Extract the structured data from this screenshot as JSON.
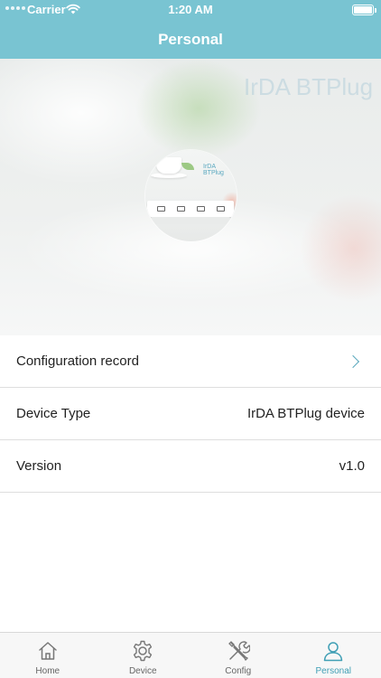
{
  "status_bar": {
    "carrier": "Carrier",
    "time": "1:20 AM"
  },
  "nav": {
    "title": "Personal"
  },
  "hero": {
    "watermark": "IrDA BTPlug",
    "logo_label": "IrDA BTPlug"
  },
  "list": {
    "rows": [
      {
        "label": "Configuration record",
        "value": ""
      },
      {
        "label": "Device Type",
        "value": "IrDA BTPlug device"
      },
      {
        "label": "Version",
        "value": "v1.0"
      }
    ]
  },
  "tabbar": {
    "tabs": [
      {
        "label": "Home",
        "icon": "home-icon"
      },
      {
        "label": "Device",
        "icon": "gear-icon"
      },
      {
        "label": "Config",
        "icon": "tools-icon"
      },
      {
        "label": "Personal",
        "icon": "person-icon"
      }
    ],
    "active_index": 3
  },
  "colors": {
    "header": "#79c4d2",
    "accent": "#3f9fb5"
  }
}
